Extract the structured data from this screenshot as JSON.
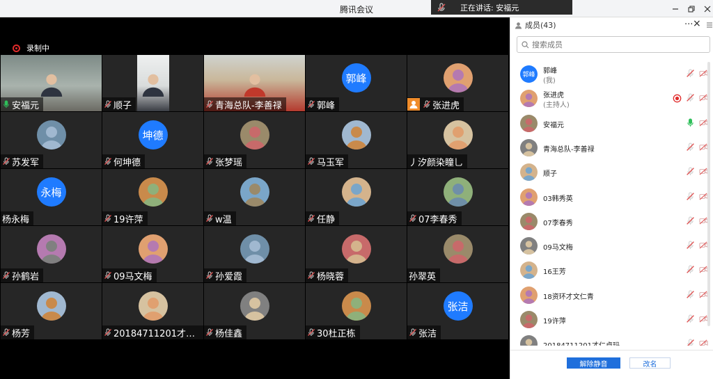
{
  "window": {
    "title": "腾讯会议",
    "speaking_label": "正在讲话: 安福元"
  },
  "meeting": {
    "recording_label": "录制中"
  },
  "tiles": [
    {
      "name": "安福元",
      "kind": "video",
      "active": true,
      "mic": "on"
    },
    {
      "name": "顺子",
      "kind": "video",
      "mic": "off"
    },
    {
      "name": "青海总队-李善禄",
      "kind": "video",
      "mic": "off"
    },
    {
      "name": "郭峰",
      "kind": "text",
      "avatar_text": "郭峰",
      "mic": "off"
    },
    {
      "name": "张进虎",
      "kind": "photo",
      "mic": "off",
      "host": true
    },
    {
      "name": "苏发军",
      "kind": "photo",
      "mic": "off"
    },
    {
      "name": "何坤德",
      "kind": "text",
      "avatar_text": "坤德",
      "mic": "off"
    },
    {
      "name": "张梦瑶",
      "kind": "photo",
      "mic": "off"
    },
    {
      "name": "马玉军",
      "kind": "photo",
      "mic": "off"
    },
    {
      "name": "丿汐颜染瞳乚",
      "kind": "photo",
      "mic": "none"
    },
    {
      "name": "杨永梅",
      "kind": "text",
      "avatar_text": "永梅",
      "mic": "none"
    },
    {
      "name": "19许萍",
      "kind": "photo",
      "mic": "off"
    },
    {
      "name": "w温",
      "kind": "photo",
      "mic": "off"
    },
    {
      "name": "任静",
      "kind": "photo",
      "mic": "off"
    },
    {
      "name": "07李春秀",
      "kind": "photo",
      "mic": "off"
    },
    {
      "name": "孙鹤岩",
      "kind": "photo",
      "mic": "off"
    },
    {
      "name": "09马文梅",
      "kind": "photo",
      "mic": "off"
    },
    {
      "name": "孙爱霞",
      "kind": "photo",
      "mic": "off"
    },
    {
      "name": "杨晓蓉",
      "kind": "photo",
      "mic": "off"
    },
    {
      "name": "孙翠英",
      "kind": "photo",
      "mic": "none"
    },
    {
      "name": "杨芳",
      "kind": "photo",
      "mic": "off"
    },
    {
      "name": "2018471120​1才仁...",
      "kind": "photo",
      "mic": "off"
    },
    {
      "name": "杨佳鑫",
      "kind": "photo",
      "mic": "off"
    },
    {
      "name": "30杜正栋",
      "kind": "photo",
      "mic": "off"
    },
    {
      "name": "张洁",
      "kind": "text",
      "avatar_text": "张洁",
      "mic": "off"
    }
  ],
  "panel": {
    "header": "成员(43)",
    "more_label": "···",
    "close_label": "×",
    "search_placeholder": "搜索成员",
    "members": [
      {
        "name": "郭峰",
        "sub": "(我)",
        "avatar_text": "郭峰",
        "mic": "off"
      },
      {
        "name": "张进虎",
        "sub": "(主持人)",
        "mic": "off",
        "rec": true
      },
      {
        "name": "安福元",
        "mic": "on"
      },
      {
        "name": "青海总队-李善禄",
        "mic": "off"
      },
      {
        "name": "顺子",
        "mic": "off"
      },
      {
        "name": "03韩秀英",
        "mic": "off"
      },
      {
        "name": "07李春秀",
        "mic": "off"
      },
      {
        "name": "09马文梅",
        "mic": "off"
      },
      {
        "name": "16王芳",
        "mic": "off"
      },
      {
        "name": "18资环才文仁青",
        "mic": "off"
      },
      {
        "name": "19许萍",
        "mic": "off"
      },
      {
        "name": "20184711201才仁卓玛",
        "mic": "off"
      }
    ],
    "unmute_all_label": "解除静音",
    "rename_label": "改名"
  },
  "colors": {
    "accent": "#1f7bff",
    "muted_red": "#e05555",
    "mic_on_green": "#2fbf5a",
    "rec_red": "#e02b2b"
  }
}
